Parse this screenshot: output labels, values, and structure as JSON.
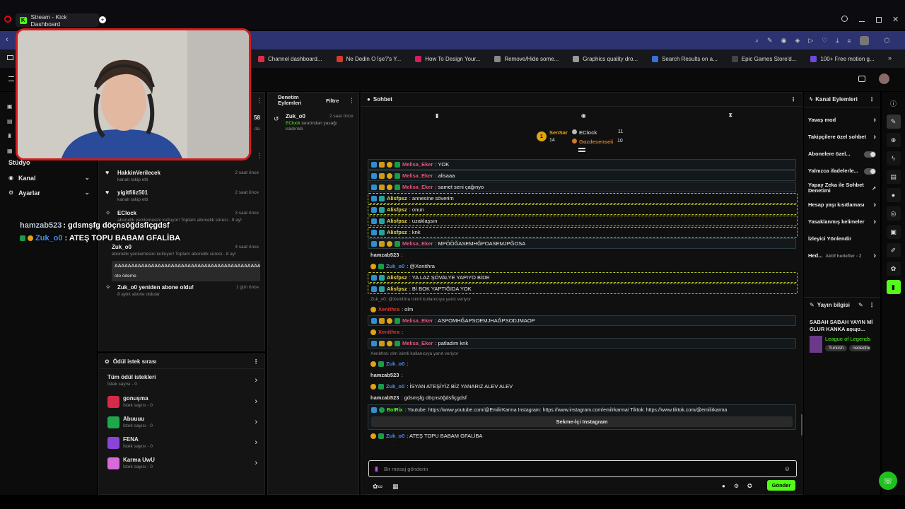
{
  "browser": {
    "tab_title": "Stream - Kick Dashboard",
    "bookmarks": [
      {
        "label": "Channel dashboard...",
        "color": "#e02c4a"
      },
      {
        "label": "Ne Dedin O İşe?'s Y...",
        "color": "#d83a2a"
      },
      {
        "label": "How To Design Your...",
        "color": "#d02060"
      },
      {
        "label": "Remove/Hide some...",
        "color": "#888888"
      },
      {
        "label": "Graphics quality dro...",
        "color": "#999999"
      },
      {
        "label": "Search Results on a...",
        "color": "#3a6fd8"
      },
      {
        "label": "Epic Games Store'd...",
        "color": "#444444"
      },
      {
        "label": "100+ Free motion g...",
        "color": "#6a4cd8"
      }
    ]
  },
  "left_nav": {
    "items": [
      "Stüdyo",
      "Kanal",
      "Ayarlar"
    ],
    "overlay_line1_user": "hamzab523",
    "overlay_line1_text": ": gdsmşfg döçnsöğdsfiçgdsf",
    "overlay_line2_user": "Zuk_o0",
    "overlay_line2_text": ": ATEŞ TOPU BABAM GFALİBA",
    "time_fragment": "58",
    "da_fragment": "da"
  },
  "activity": {
    "events": [
      {
        "title": "HakkinVerilecek",
        "sub": "kanalı takip etti",
        "time": "2 saat önce"
      },
      {
        "title": "yigitfiliz501",
        "sub": "kanalı takip etti",
        "time": "2 saat önce"
      },
      {
        "title": "EClock",
        "sub": "abonelik yenilemesini kutluyor! Toplam abonelik süresi - 9 ay!",
        "time": "3 saat önce"
      },
      {
        "title": "Zuk_o0",
        "sub": "abonelik yenilemesini kutluyor! Toplam abonelik süresi - 8 ay!",
        "time": "4 saat önce",
        "extra": "AAAAAAAAAAAAAAAAAAAAAAAAAAAAAAAAAAAAAAAAAAAAA",
        "extra2": "oto ödeme"
      },
      {
        "title": "Zuk_o0 yeniden abone oldu!",
        "sub": "8 aylık abone oldular",
        "time": "1 gün önce"
      }
    ]
  },
  "mod_actions": {
    "title": "Denetim Eylemleri",
    "filter": "Filtre",
    "item_user": "Zuk_o0",
    "item_time": "2 saat önce",
    "item_actor": "EClock",
    "item_text": "tarafından yasağı kaldırıldı"
  },
  "rewards": {
    "title": "Ödül istek sırası",
    "items": [
      {
        "name": "Tüm ödül istekleri",
        "sub": "İstek sayısı - 0",
        "color": ""
      },
      {
        "name": "gonuşma",
        "sub": "İstek sayısı - 0",
        "color": "#d62a4a"
      },
      {
        "name": "Abuuuu",
        "sub": "İstek sayısı - 0",
        "color": "#1ea84a"
      },
      {
        "name": "FENA",
        "sub": "İstek sayısı - 0",
        "color": "#8a44d8"
      },
      {
        "name": "Karma UwU",
        "sub": "İstek sayısı - 0",
        "color": "#d66ad8"
      }
    ]
  },
  "chat": {
    "title": "Sohbet",
    "leaderboard": {
      "first": "SenSar",
      "first_count": "14",
      "second": "EClock",
      "second_count": "11",
      "third": "Gozdesenseii",
      "third_count": "10"
    },
    "messages": [
      {
        "user": "Melisa_Eker",
        "text": ": YOK",
        "style": "boxed",
        "color": "#e8547a"
      },
      {
        "user": "Melisa_Eker",
        "text": ": alisaaa",
        "style": "boxed",
        "color": "#e8547a"
      },
      {
        "user": "Melisa_Eker",
        "text": ": samet seni çağınyo",
        "style": "boxed",
        "color": "#e8547a"
      },
      {
        "user": "Alisfpsz",
        "text": ": annesine söverim",
        "style": "dash",
        "color": "#e8d84a"
      },
      {
        "user": "Alisfpsz",
        "text": ": onun",
        "style": "dash",
        "color": "#e8d84a"
      },
      {
        "user": "Alisfpsz",
        "text": ": uzaklaşsın",
        "style": "dash",
        "color": "#e8d84a"
      },
      {
        "user": "Alisfpsz",
        "text": ": knk",
        "style": "dash",
        "color": "#e8d84a"
      },
      {
        "user": "Melisa_Eker",
        "text": ": MPÖÖĞASEMHĞPOASEMJPĞOSA",
        "style": "boxed",
        "color": "#e8547a"
      },
      {
        "user": "hamzab523",
        "text": ":",
        "style": "plain",
        "color": "#dddddd"
      },
      {
        "user": "Zuk_o0",
        "text": ": @Xenithra",
        "style": "plain",
        "color": "#4a8cf0"
      },
      {
        "user": "Alisfpsz",
        "text": ": YA LAZ ŞÖVALYE YAPIYO BİDE",
        "style": "dash",
        "color": "#e8d84a"
      },
      {
        "user": "Alisfpsz",
        "text": ": Bİ BOK YAPTIĞIDA YOK",
        "style": "dash",
        "color": "#e8d84a"
      },
      {
        "reply": "Zuk_o0: @Xenithra                 isimli kullanıcıya yanıt veriyor"
      },
      {
        "user": "Xenithra",
        "text": ": olm",
        "style": "plain",
        "color": "#d83a3a"
      },
      {
        "user": "Melisa_Eker",
        "text": ": ASPOMHĞAPSOEMJHAĞPSODJMAOP",
        "style": "boxed",
        "color": "#e8547a"
      },
      {
        "user": "Xenithra",
        "text": ":",
        "style": "plain",
        "color": "#d83a3a"
      },
      {
        "user": "Melisa_Eker",
        "text": ": patladım knk",
        "style": "boxed",
        "color": "#e8547a"
      },
      {
        "reply": "Xenithra: olm isimli kullanıcıya yanıt veriyor"
      },
      {
        "user": "Zuk_o0",
        "text": ":",
        "style": "plain",
        "color": "#4a8cf0"
      },
      {
        "user": "hamzab523",
        "text": ":",
        "style": "plain",
        "color": "#dddddd"
      },
      {
        "user": "Zuk_o0",
        "text": ": İSYAN ATEŞİYİZ BİZ YANARIZ ALEV ALEV",
        "style": "plain",
        "color": "#4a8cf0"
      },
      {
        "user": "hamzab523",
        "text": ": gdsmşfg döçnsöğdsfiçgdsf",
        "style": "plain",
        "color": "#dddddd"
      }
    ],
    "botrix": {
      "user": "BotRix",
      "text": ": Youtube: https://www.youtube.com/@EmilirKarma Instagram: https://www.instagram.com/emilrkarma/ Tiktok: https://www.tiktok.com/@emilirkarma",
      "button": "Sekme-İçi Instagram"
    },
    "last": {
      "user": "Zuk_o0",
      "text": ": ATEŞ TOPU BABAM GFALİBA"
    },
    "emote_row_label": "Takipçilere Özel",
    "input_placeholder": "Bir mesaj gönderin",
    "send": "Gönder"
  },
  "channel_actions": {
    "title": "Kanal Eylemleri",
    "items": [
      {
        "label": "Yavaş mod",
        "control": "chevron"
      },
      {
        "label": "Takipçilere özel sohbet",
        "control": "chevron"
      },
      {
        "label": "Abonelere özel...",
        "control": "toggle"
      },
      {
        "label": "Yalnızca ifadelerle...",
        "control": "toggle"
      },
      {
        "label": "Yapay Zeka ile Sohbet Denetimi",
        "control": "link"
      },
      {
        "label": "Hesap yaşı kısıtlaması",
        "control": "chevron"
      },
      {
        "label": "Yasaklanmış kelimeler",
        "control": "chevron"
      },
      {
        "label": "İzleyici Yönlendir",
        "control": "none"
      },
      {
        "label": "Hed...",
        "control": "chevron",
        "sub": "Aktif hedefler - 2"
      }
    ]
  },
  "stream_info": {
    "title": "Yayın bilgisi",
    "stream_title": "SABAH SABAH YAYIN Mİ OLUR KANKA ɕǫɰʋ...",
    "game": "League of Legends",
    "tags": [
      "Turkish",
      "nededing"
    ]
  },
  "colors": {
    "kick_green": "#53fc18",
    "accent_blue": "#2d3270"
  }
}
